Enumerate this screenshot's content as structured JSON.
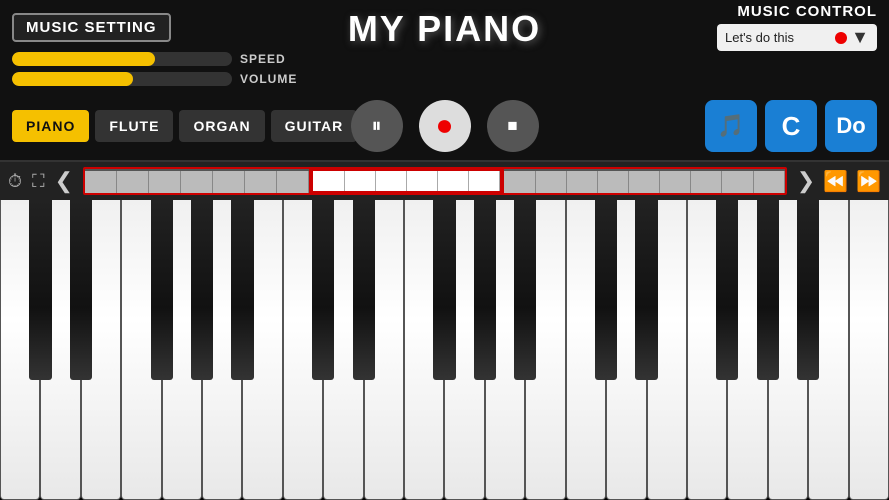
{
  "header": {
    "music_setting_label": "MUSIC SETTING",
    "app_title": "MY PIANO",
    "music_control_label": "MUSIC CONTROL",
    "dropdown_text": "Let's do this"
  },
  "sliders": {
    "speed": {
      "label": "SPEED",
      "fill_percent": 65
    },
    "volume": {
      "label": "VOLUME",
      "fill_percent": 55
    }
  },
  "instruments": [
    {
      "id": "piano",
      "label": "PIANO",
      "active": true
    },
    {
      "id": "flute",
      "label": "FLUTE",
      "active": false
    },
    {
      "id": "organ",
      "label": "ORGAN",
      "active": false
    },
    {
      "id": "guitar",
      "label": "GUITAR",
      "active": false
    }
  ],
  "playback": {
    "pause_icon": "⏸",
    "record_icon": "⏺",
    "stop_icon": "⏹"
  },
  "right_buttons": {
    "music_note": "🎵",
    "note_c": "C",
    "note_do": "Do"
  },
  "nav": {
    "timer_icon": "⏱",
    "expand_icon": "⛶",
    "left_arrow": "❮",
    "right_arrow": "❯",
    "rewind_icon": "⏮",
    "forward_icon": "⏭"
  },
  "piano": {
    "white_key_count": 22,
    "colors": {
      "white_key": "#f8f8f8",
      "black_key": "#111",
      "border": "#555",
      "active_section": "#c00"
    }
  }
}
